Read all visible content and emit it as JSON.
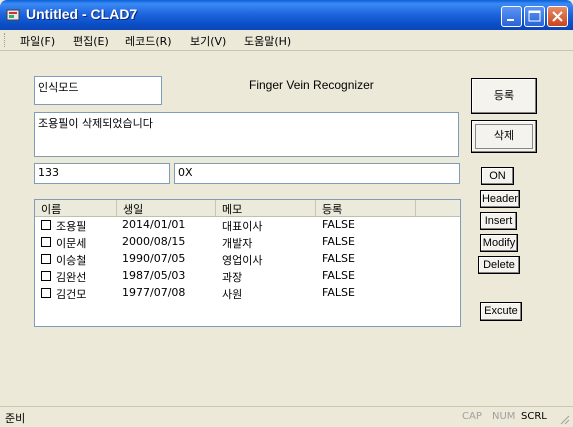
{
  "window": {
    "title": "Untitled - CLAD7"
  },
  "menu": [
    "파일(F)",
    "편집(E)",
    "레코드(R)",
    "보기(V)",
    "도움말(H)"
  ],
  "fields": {
    "mode": "인식모드",
    "app_label": "Finger Vein Recognizer",
    "message": "조용필이 삭제되었습니다",
    "id_value": "133",
    "hex_value": "0X"
  },
  "buttons": {
    "register": "등록",
    "delete": "삭제",
    "on": "ON",
    "header": "Header",
    "insert": "Insert",
    "modify": "Modify",
    "delete_en": "Delete",
    "execute": "Excute"
  },
  "table": {
    "columns": [
      "이름",
      "생일",
      "메모",
      "등록"
    ],
    "rows": [
      {
        "name": "조용필",
        "birth": "2014/01/01",
        "memo": "대표이사",
        "reg": "FALSE"
      },
      {
        "name": "이문세",
        "birth": "2000/08/15",
        "memo": "개발자",
        "reg": "FALSE"
      },
      {
        "name": "이승철",
        "birth": "1990/07/05",
        "memo": "영업이사",
        "reg": "FALSE"
      },
      {
        "name": "김완선",
        "birth": "1987/05/03",
        "memo": "과장",
        "reg": "FALSE"
      },
      {
        "name": "김건모",
        "birth": "1977/07/08",
        "memo": "사원",
        "reg": "FALSE"
      }
    ]
  },
  "status": {
    "text": "준비",
    "cap": "CAP",
    "num": "NUM",
    "scrl": "SCRL"
  },
  "colors": {
    "titlebar": "#1f66df",
    "face": "#ece9d8",
    "edit_border": "#7f9db9"
  }
}
